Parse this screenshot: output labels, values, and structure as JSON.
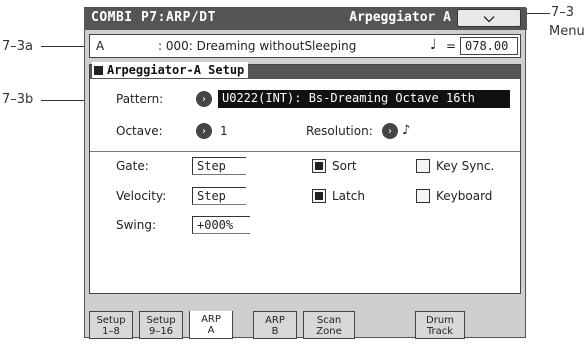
{
  "callouts": {
    "c73": "7–3",
    "menu": "Menu",
    "c73a": "7–3a",
    "c73b": "7–3b"
  },
  "title": {
    "left": "COMBI P7:ARP/DT",
    "right": "Arpeggiator A",
    "menu_icon": "chevron-down-icon",
    "menu_glyph": "⌄"
  },
  "combi": {
    "bank": "A",
    "name": ": 000: Dreaming withoutSleeping",
    "tempo_symbol": "♩",
    "tempo_eq": "=",
    "tempo": "078.00"
  },
  "panel": {
    "title": "Arpeggiator-A Setup",
    "pattern_label": "Pattern:",
    "pattern_value": "U0222(INT): Bs-Dreaming Octave 16th",
    "octave_label": "Octave:",
    "octave_value": "1",
    "resolution_label": "Resolution:",
    "resolution_value": "♪",
    "gate_label": "Gate:",
    "gate_value": "Step",
    "velocity_label": "Velocity:",
    "velocity_value": "Step",
    "swing_label": "Swing:",
    "swing_value": "+000%",
    "sort_label": "Sort",
    "sort_checked": true,
    "latch_label": "Latch",
    "latch_checked": true,
    "keysync_label": "Key Sync.",
    "keysync_checked": false,
    "keyboard_label": "Keyboard",
    "keyboard_checked": false,
    "popup_glyph": "›"
  },
  "tabs": [
    {
      "line1": "Setup",
      "line2": "1–8"
    },
    {
      "line1": "Setup",
      "line2": "9–16"
    },
    {
      "line1": "ARP",
      "line2": "A"
    },
    {
      "line1": "ARP",
      "line2": "B"
    },
    {
      "line1": "Scan",
      "line2": "Zone"
    },
    {
      "line1": "Drum",
      "line2": "Track"
    }
  ]
}
